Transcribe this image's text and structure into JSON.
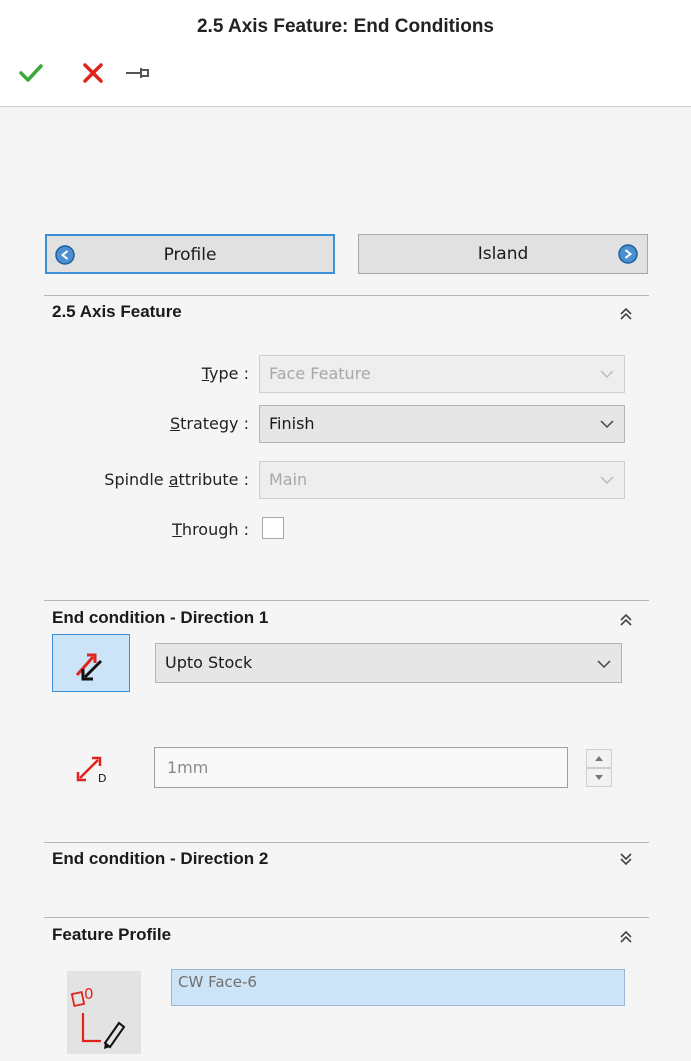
{
  "title": "2.5 Axis Feature: End Conditions",
  "toolbar": {
    "ok_icon": "check-icon",
    "cancel_icon": "close-icon",
    "pin_icon": "pin-icon"
  },
  "nav": {
    "prev_label": "Profile",
    "next_label": "Island"
  },
  "axis_section": {
    "title": "2.5 Axis Feature",
    "type": {
      "label_prefix": "",
      "label_u": "T",
      "label_rest": "ype :",
      "value": "Face Feature",
      "enabled": false
    },
    "strategy": {
      "label_prefix": "",
      "label_u": "S",
      "label_rest": "trategy :",
      "value": "Finish",
      "enabled": true
    },
    "spindle": {
      "label_prefix": "Spindle ",
      "label_u": "a",
      "label_rest": "ttribute :",
      "value": "Main",
      "enabled": false
    },
    "through": {
      "label_prefix": "",
      "label_u": "T",
      "label_rest": "hrough :",
      "checked": false
    }
  },
  "dir1_section": {
    "title": "End condition - Direction 1",
    "end_type": "Upto Stock",
    "depth_value": "1mm",
    "depth_icon_label": "D"
  },
  "dir2_section": {
    "title": "End condition - Direction 2"
  },
  "profile_section": {
    "title": "Feature Profile",
    "value": "CW Face-6",
    "icon_label": "0"
  },
  "colors": {
    "accent_blue": "#3c8fd9",
    "ok_green": "#3aa83a",
    "cancel_red": "#e0241b",
    "selection_bg": "#cce4f7"
  }
}
